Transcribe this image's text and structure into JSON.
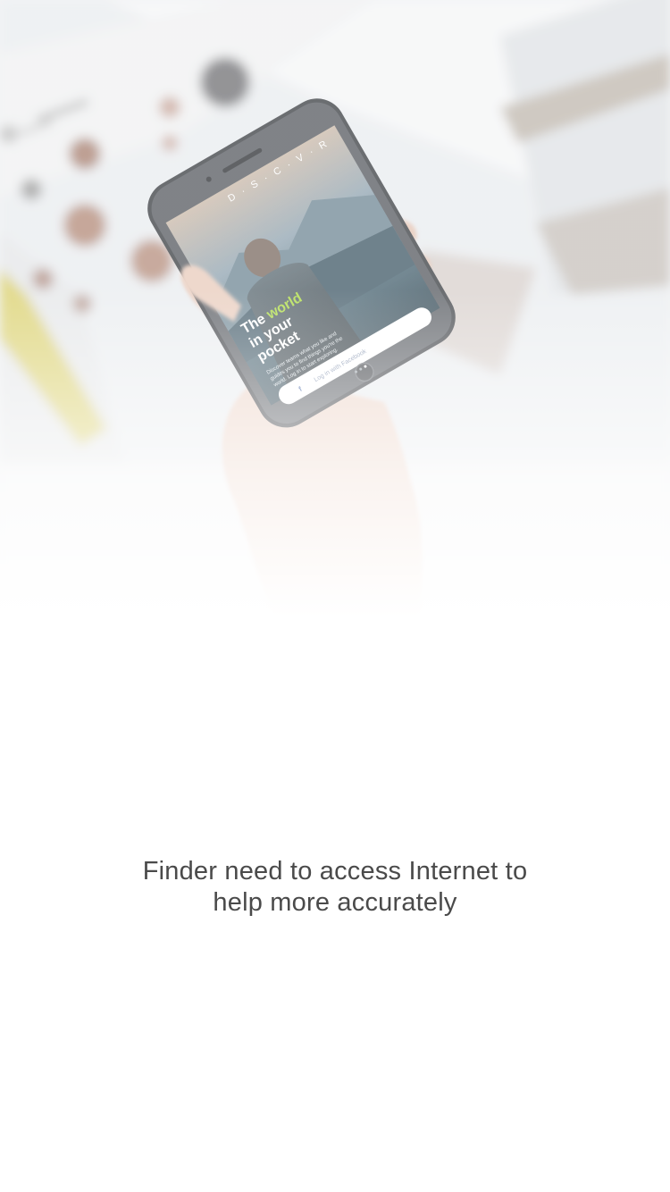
{
  "hero": {
    "phone_screen": {
      "brand": "D · S · C · V · R",
      "headline_prefix": "The ",
      "headline_highlight": "world",
      "headline_line2": "in your",
      "headline_line3": "pocket",
      "description_line1": "Discover teams what you like and",
      "description_line2": "guides you to find things you're the",
      "description_line3": "world. Log in to start exploring.",
      "login_button_label": "Log in with Facebook",
      "facebook_glyph": "f"
    },
    "colors": {
      "highlight": "#a8d93a",
      "phone_body": "#3a3d42"
    }
  },
  "message": {
    "line1": "Finder need to access Internet to",
    "line2": "help more accurately",
    "color": "#4a4a4a"
  }
}
